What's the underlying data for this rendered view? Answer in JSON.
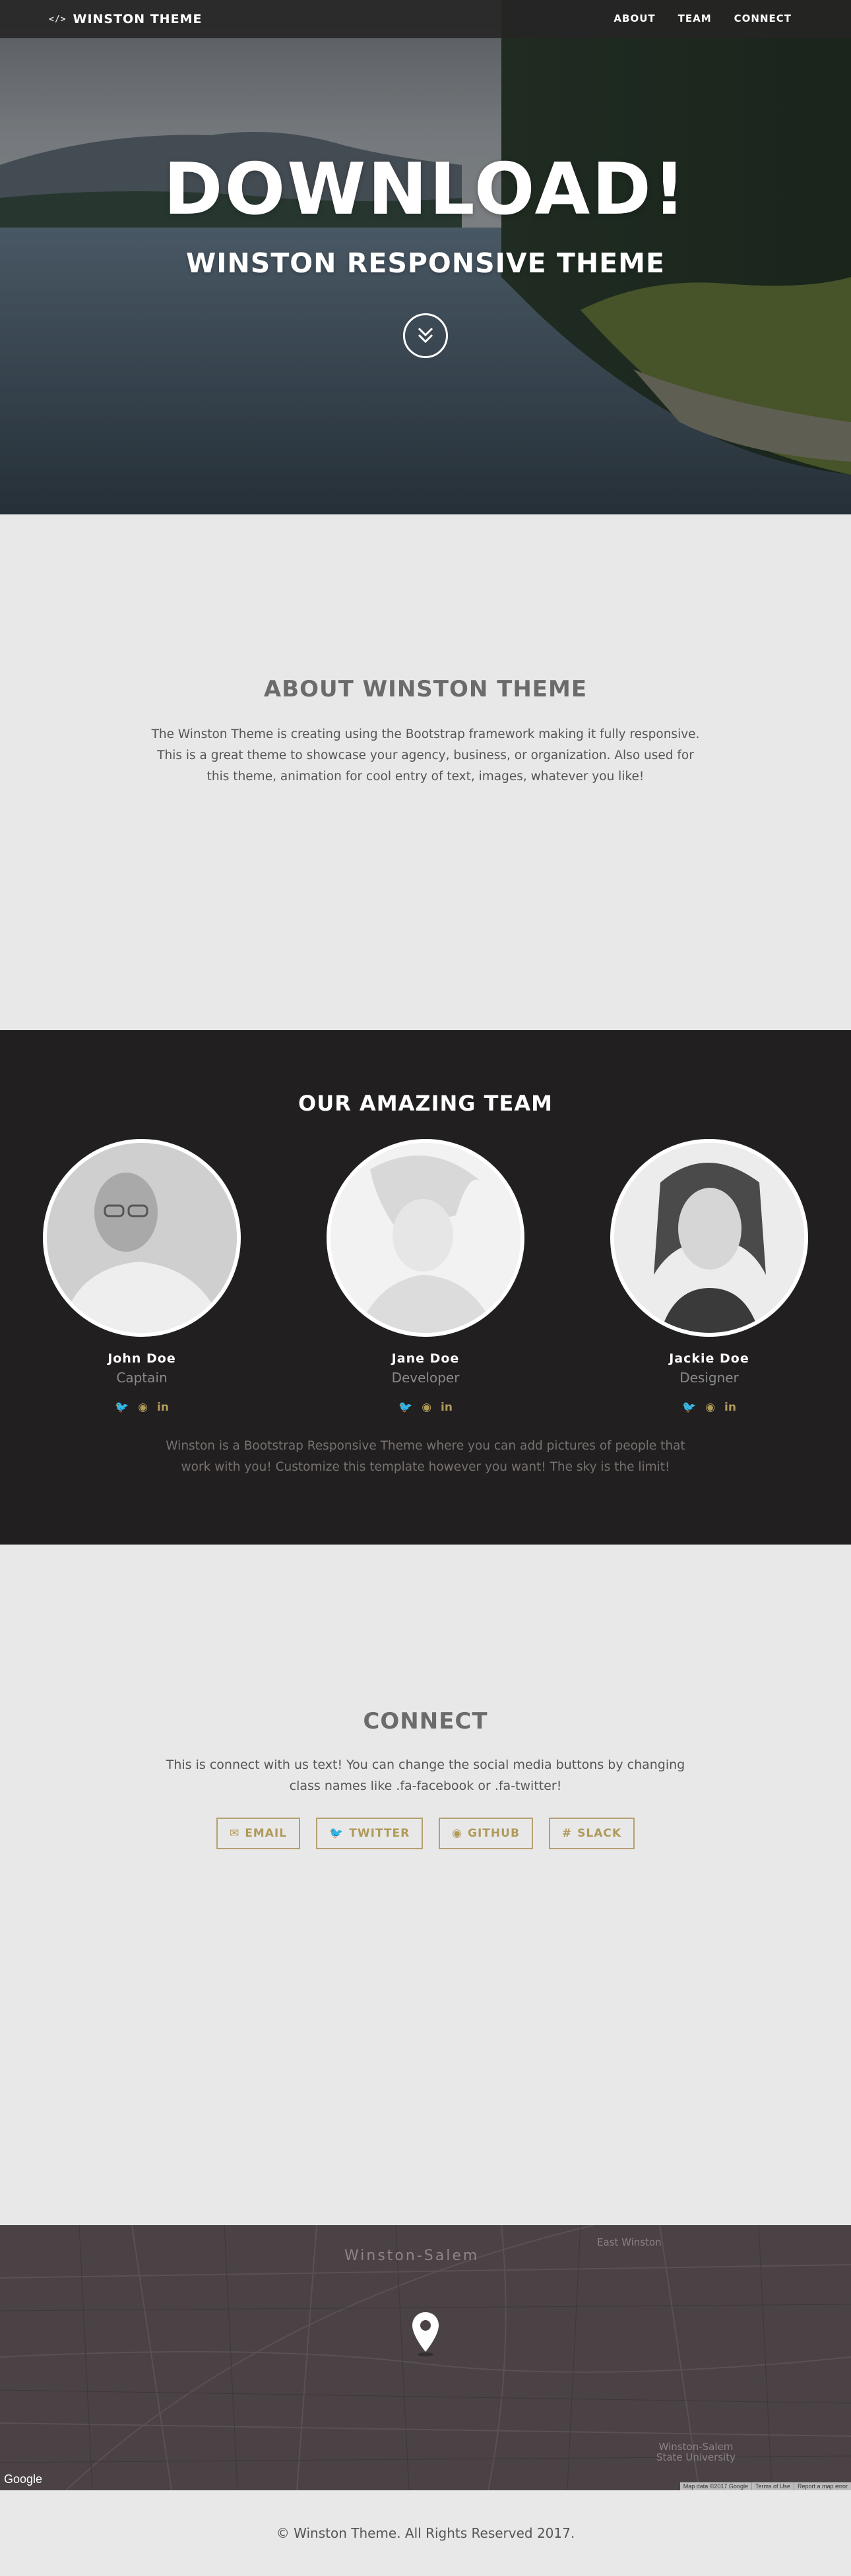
{
  "nav": {
    "brand_icon": "code-icon",
    "brand_glyph": "</>",
    "brand": "WINSTON THEME",
    "links": [
      "ABOUT",
      "TEAM",
      "CONNECT"
    ]
  },
  "hero": {
    "title": "DOWNLOAD!",
    "subtitle": "WINSTON RESPONSIVE THEME",
    "scroll_icon": "double-chevron-down-icon"
  },
  "about": {
    "title": "ABOUT WINSTON THEME",
    "text": "The Winston Theme is creating using the Bootstrap framework making it fully responsive. This is a great theme to showcase your agency, business, or organization. Also used for this theme, animation for cool entry of text, images, whatever you like!"
  },
  "team": {
    "title": "OUR AMAZING TEAM",
    "members": [
      {
        "name": "John Doe",
        "role": "Captain"
      },
      {
        "name": "Jane Doe",
        "role": "Developer"
      },
      {
        "name": "Jackie Doe",
        "role": "Designer"
      }
    ],
    "social_icons": [
      "twitter-icon",
      "github-icon",
      "linkedin-icon"
    ],
    "text": "Winston is a Bootstrap Responsive Theme where you can add pictures of people that work with you! Customize this template however you want! The sky is the limit!"
  },
  "connect": {
    "title": "CONNECT",
    "text": "This is connect with us text! You can change the social media buttons by changing class names like .fa-facebook or .fa-twitter!",
    "buttons": [
      {
        "label": "EMAIL",
        "icon": "envelope-icon"
      },
      {
        "label": "TWITTER",
        "icon": "twitter-icon"
      },
      {
        "label": "GITHUB",
        "icon": "github-icon"
      },
      {
        "label": "SLACK",
        "icon": "slack-icon"
      }
    ]
  },
  "map": {
    "city": "Winston-Salem",
    "area_east": "East Winston",
    "area_university": "Winston-Salem State University",
    "google": "Google",
    "attribution": [
      "Map data ©2017 Google",
      "Terms of Use",
      "Report a map error"
    ]
  },
  "footer": {
    "text": "© Winston Theme. All Rights Reserved 2017."
  },
  "colors": {
    "accent": "#b09a5a",
    "dark": "#221f20",
    "light": "#e8e8e8"
  }
}
